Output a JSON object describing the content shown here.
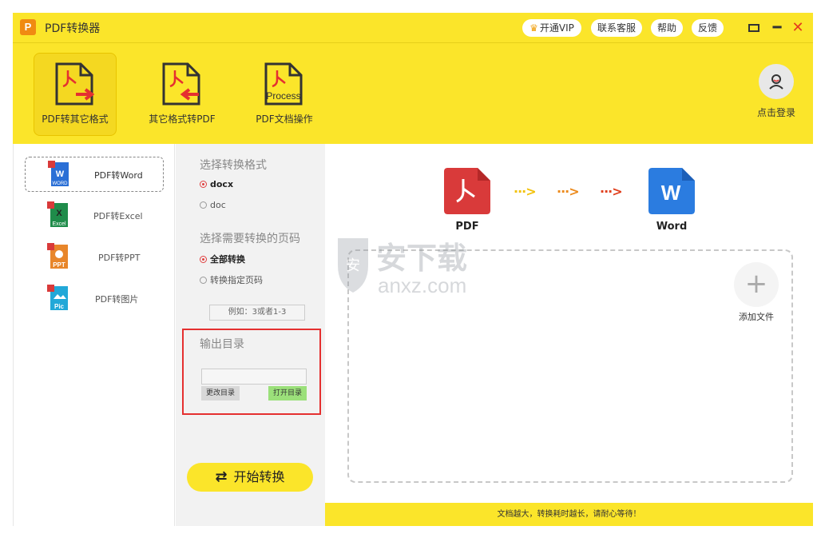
{
  "app": {
    "title": "PDF转换器",
    "logo_letter": "P"
  },
  "titlebar": {
    "vip": "开通VIP",
    "service": "联系客服",
    "help": "帮助",
    "feedback": "反馈"
  },
  "toolbar": {
    "items": [
      {
        "label": "PDF转其它格式",
        "active": true
      },
      {
        "label": "其它格式转PDF",
        "active": false
      },
      {
        "label": "PDF文档操作",
        "active": false
      }
    ],
    "process_text": "Process",
    "login": "点击登录"
  },
  "formats": [
    {
      "label": "PDF转Word",
      "icon_text": "WORD",
      "color": "#2a6fd6"
    },
    {
      "label": "PDF转Excel",
      "icon_text": "Excel",
      "color": "#1f8c4a"
    },
    {
      "label": "PDF转PPT",
      "icon_text": "PPT",
      "color": "#e8862a"
    },
    {
      "label": "PDF转图片",
      "icon_text": "Pic",
      "color": "#22a8d8"
    }
  ],
  "options": {
    "format_title": "选择转换格式",
    "format_opts": [
      "docx",
      "doc"
    ],
    "pages_title": "选择需要转换的页码",
    "pages_opts": [
      "全部转换",
      "转换指定页码"
    ],
    "pages_placeholder": "例如：3或者1-3",
    "output_title": "输出目录",
    "change_dir": "更改目录",
    "open_dir": "打开目录",
    "start": "开始转换"
  },
  "main": {
    "from_label": "PDF",
    "to_label": "Word",
    "to_icon_letter": "W",
    "add_file": "添加文件",
    "footer_note": "文档越大，转换耗时越长，请耐心等待！"
  },
  "watermark": {
    "cn": "安下载",
    "en": "anxz.com"
  },
  "colors": {
    "brand_yellow": "#fbe52a",
    "pdf_red": "#d93a3a",
    "word_blue": "#2b7ce0",
    "highlight_red": "#e53030"
  }
}
